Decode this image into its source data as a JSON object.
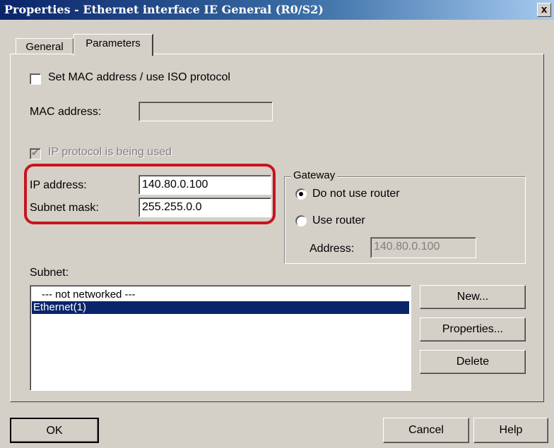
{
  "dialog": {
    "title": "Properties - Ethernet interface  IE General (R0/S2)",
    "close_label": "x"
  },
  "tabs": [
    {
      "label": "General",
      "active": false
    },
    {
      "label": "Parameters",
      "active": true
    }
  ],
  "mac": {
    "checkbox_label": "Set MAC address / use ISO protocol",
    "checked": false,
    "address_label": "MAC address:",
    "address_value": ""
  },
  "ip": {
    "protocol_label": "IP protocol is being used",
    "protocol_checked": true,
    "address_label": "IP address:",
    "address_value": "140.80.0.100",
    "subnet_mask_label": "Subnet mask:",
    "subnet_mask_value": "255.255.0.0"
  },
  "gateway": {
    "title": "Gateway",
    "option_no_router": "Do not use router",
    "option_use_router": "Use router",
    "selected": "no_router",
    "address_label": "Address:",
    "address_value": "140.80.0.100"
  },
  "subnet": {
    "label": "Subnet:",
    "items": [
      {
        "label": "--- not networked ---",
        "selected": false
      },
      {
        "label": "Ethernet(1)",
        "selected": true
      }
    ]
  },
  "side_buttons": {
    "new": "New...",
    "properties": "Properties...",
    "delete": "Delete"
  },
  "footer": {
    "ok": "OK",
    "cancel": "Cancel",
    "help": "Help"
  },
  "colors": {
    "highlight": "#c8141e",
    "selection": "#0a246a",
    "titlebar": "#0a246a"
  }
}
